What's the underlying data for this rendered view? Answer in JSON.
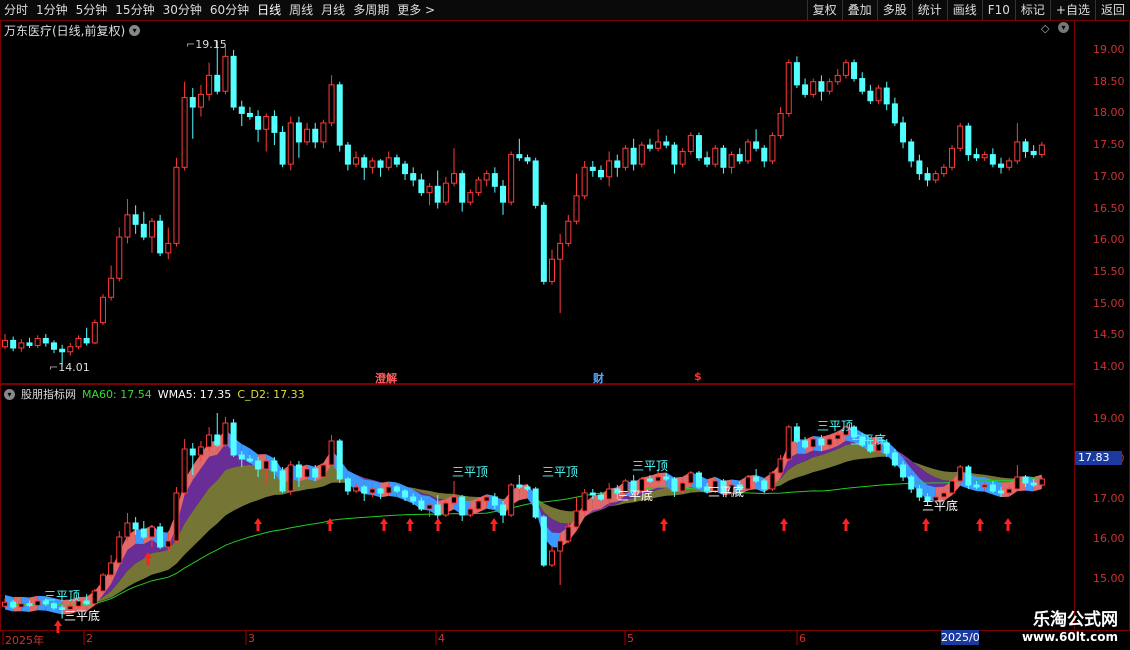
{
  "toolbar": {
    "periods": [
      "分时",
      "1分钟",
      "5分钟",
      "15分钟",
      "30分钟",
      "60分钟",
      "日线",
      "周线",
      "月线",
      "多周期",
      "更多 >"
    ],
    "active": "日线",
    "right_buttons": [
      "复权",
      "叠加",
      "多股",
      "统计",
      "画线",
      "F10",
      "标记",
      "+自选",
      "返回"
    ]
  },
  "stock": {
    "title": "万东医疗(日线,前复权)",
    "high_label": "19.15",
    "low_label": "14.01"
  },
  "main_axis": [
    "19.00",
    "18.50",
    "18.00",
    "17.50",
    "17.00",
    "16.50",
    "16.00",
    "15.50",
    "15.00",
    "14.50",
    "14.00"
  ],
  "events": [
    {
      "label": "澄解",
      "color": "#ff6060"
    },
    {
      "label": "财",
      "color": "#55aaff"
    },
    {
      "label": "$",
      "color": "#ff3030"
    }
  ],
  "indicator": {
    "name": "股朋指标网",
    "ma60_label": "MA60: 17.54",
    "wma5_label": "WMA5: 17.35",
    "cd2_label": "C_D2: 17.33",
    "current": "17.83",
    "axis": [
      "19.00",
      "18.00",
      "17.00",
      "16.00",
      "15.00"
    ],
    "signals": [
      "三平顶",
      "三平顶",
      "三平顶",
      "三平顶",
      "三平顶",
      "三平底",
      "三平底",
      "三平底",
      "三平底",
      "三平底"
    ]
  },
  "dates": [
    "2025年",
    "2",
    "3",
    "4",
    "5",
    "6",
    "2025/0"
  ],
  "watermark": {
    "line1": "乐淘公式网",
    "line2": "www.60lt.com"
  },
  "colors": {
    "up": "#ff3b3b",
    "down": "#54ffff",
    "ma60": "#22cc22",
    "purple": "#7a35b0",
    "olive": "#8a8a40",
    "pink": "#e06a6a",
    "blue": "#3a9aff"
  },
  "candles": [
    [
      14.32,
      14.42,
      14.52,
      14.28
    ],
    [
      14.42,
      14.3,
      14.48,
      14.25
    ],
    [
      14.3,
      14.38,
      14.44,
      14.24
    ],
    [
      14.38,
      14.34,
      14.46,
      14.3
    ],
    [
      14.34,
      14.45,
      14.5,
      14.3
    ],
    [
      14.45,
      14.38,
      14.52,
      14.32
    ],
    [
      14.38,
      14.28,
      14.42,
      14.22
    ],
    [
      14.28,
      14.24,
      14.35,
      14.01
    ],
    [
      14.24,
      14.32,
      14.38,
      14.18
    ],
    [
      14.32,
      14.45,
      14.5,
      14.28
    ],
    [
      14.45,
      14.38,
      14.62,
      14.34
    ],
    [
      14.38,
      14.7,
      14.75,
      14.36
    ],
    [
      14.7,
      15.1,
      15.15,
      14.66
    ],
    [
      15.1,
      15.4,
      15.6,
      15.05
    ],
    [
      15.4,
      16.05,
      16.2,
      15.35
    ],
    [
      16.05,
      16.4,
      16.65,
      15.95
    ],
    [
      16.4,
      16.25,
      16.55,
      16.1
    ],
    [
      16.25,
      16.05,
      16.45,
      16.0
    ],
    [
      16.05,
      16.3,
      16.35,
      15.8
    ],
    [
      16.3,
      15.8,
      16.4,
      15.75
    ],
    [
      15.8,
      15.95,
      16.2,
      15.7
    ],
    [
      15.95,
      17.15,
      17.3,
      15.9
    ],
    [
      17.15,
      18.25,
      18.5,
      17.1
    ],
    [
      18.25,
      18.1,
      18.4,
      17.6
    ],
    [
      18.1,
      18.3,
      18.45,
      17.95
    ],
    [
      18.3,
      18.6,
      18.8,
      18.2
    ],
    [
      18.6,
      18.35,
      19.15,
      18.3
    ],
    [
      18.35,
      18.9,
      19.05,
      18.3
    ],
    [
      18.9,
      18.1,
      19.0,
      18.05
    ],
    [
      18.1,
      18.0,
      18.2,
      17.8
    ],
    [
      18.0,
      17.95,
      18.1,
      17.9
    ],
    [
      17.95,
      17.75,
      18.05,
      17.55
    ],
    [
      17.75,
      17.95,
      18.0,
      17.4
    ],
    [
      17.95,
      17.7,
      18.05,
      17.5
    ],
    [
      17.7,
      17.2,
      17.8,
      17.15
    ],
    [
      17.2,
      17.85,
      17.95,
      17.1
    ],
    [
      17.85,
      17.55,
      17.95,
      17.3
    ],
    [
      17.55,
      17.75,
      17.85,
      17.5
    ],
    [
      17.75,
      17.55,
      17.85,
      17.45
    ],
    [
      17.55,
      17.85,
      17.9,
      17.45
    ],
    [
      17.85,
      18.45,
      18.6,
      17.8
    ],
    [
      18.45,
      17.5,
      18.5,
      17.4
    ],
    [
      17.5,
      17.2,
      17.55,
      17.1
    ],
    [
      17.2,
      17.3,
      17.4,
      17.15
    ],
    [
      17.3,
      17.15,
      17.35,
      16.95
    ],
    [
      17.15,
      17.25,
      17.3,
      17.05
    ],
    [
      17.25,
      17.15,
      17.28,
      17.0
    ],
    [
      17.15,
      17.3,
      17.4,
      17.1
    ],
    [
      17.3,
      17.2,
      17.35,
      17.15
    ],
    [
      17.2,
      17.05,
      17.25,
      16.95
    ],
    [
      17.05,
      16.95,
      17.15,
      16.85
    ],
    [
      16.95,
      16.75,
      17.05,
      16.7
    ],
    [
      16.75,
      16.85,
      16.9,
      16.55
    ],
    [
      16.85,
      16.6,
      17.1,
      16.5
    ],
    [
      16.6,
      16.9,
      17.0,
      16.55
    ],
    [
      16.9,
      17.05,
      17.45,
      16.85
    ],
    [
      17.05,
      16.6,
      17.1,
      16.45
    ],
    [
      16.6,
      16.75,
      16.8,
      16.55
    ],
    [
      16.75,
      16.95,
      17.0,
      16.7
    ],
    [
      16.95,
      17.05,
      17.1,
      16.85
    ],
    [
      17.05,
      16.85,
      17.15,
      16.75
    ],
    [
      16.85,
      16.6,
      16.95,
      16.4
    ],
    [
      16.6,
      17.35,
      17.4,
      16.55
    ],
    [
      17.35,
      17.3,
      17.6,
      17.25
    ],
    [
      17.3,
      17.25,
      17.35,
      17.2
    ],
    [
      17.25,
      16.55,
      17.3,
      16.5
    ],
    [
      16.55,
      15.35,
      16.6,
      15.3
    ],
    [
      15.35,
      15.7,
      15.85,
      15.3
    ],
    [
      15.7,
      15.95,
      16.1,
      14.85
    ],
    [
      15.95,
      16.3,
      16.4,
      15.9
    ],
    [
      16.3,
      16.7,
      17.05,
      16.25
    ],
    [
      16.7,
      17.15,
      17.25,
      16.65
    ],
    [
      17.15,
      17.1,
      17.25,
      17.0
    ],
    [
      17.1,
      17.0,
      17.18,
      16.95
    ],
    [
      17.0,
      17.25,
      17.4,
      16.85
    ],
    [
      17.25,
      17.15,
      17.35,
      17.0
    ],
    [
      17.15,
      17.45,
      17.5,
      17.1
    ],
    [
      17.45,
      17.2,
      17.6,
      17.1
    ],
    [
      17.2,
      17.5,
      17.55,
      17.15
    ],
    [
      17.5,
      17.45,
      17.6,
      17.4
    ],
    [
      17.45,
      17.55,
      17.75,
      17.4
    ],
    [
      17.55,
      17.5,
      17.65,
      17.45
    ],
    [
      17.5,
      17.2,
      17.55,
      17.05
    ],
    [
      17.2,
      17.4,
      17.45,
      17.15
    ],
    [
      17.4,
      17.65,
      17.7,
      17.35
    ],
    [
      17.65,
      17.3,
      17.7,
      17.25
    ],
    [
      17.3,
      17.2,
      17.4,
      17.15
    ],
    [
      17.2,
      17.45,
      17.5,
      17.15
    ],
    [
      17.45,
      17.15,
      17.5,
      17.05
    ],
    [
      17.15,
      17.35,
      17.4,
      17.05
    ],
    [
      17.35,
      17.25,
      17.45,
      17.2
    ],
    [
      17.25,
      17.55,
      17.6,
      17.2
    ],
    [
      17.55,
      17.45,
      17.75,
      17.4
    ],
    [
      17.45,
      17.25,
      17.5,
      17.15
    ],
    [
      17.25,
      17.65,
      17.7,
      17.2
    ],
    [
      17.65,
      18.0,
      18.1,
      17.6
    ],
    [
      18.0,
      18.8,
      18.85,
      17.95
    ],
    [
      18.8,
      18.45,
      18.9,
      18.4
    ],
    [
      18.45,
      18.3,
      18.55,
      18.25
    ],
    [
      18.3,
      18.5,
      18.55,
      18.25
    ],
    [
      18.5,
      18.35,
      18.6,
      18.2
    ],
    [
      18.35,
      18.5,
      18.55,
      18.3
    ],
    [
      18.5,
      18.6,
      18.7,
      18.45
    ],
    [
      18.6,
      18.8,
      18.85,
      18.55
    ],
    [
      18.8,
      18.55,
      18.85,
      18.5
    ],
    [
      18.55,
      18.35,
      18.65,
      18.3
    ],
    [
      18.35,
      18.2,
      18.45,
      18.15
    ],
    [
      18.2,
      18.4,
      18.45,
      18.15
    ],
    [
      18.4,
      18.15,
      18.5,
      18.05
    ],
    [
      18.15,
      17.85,
      18.25,
      17.8
    ],
    [
      17.85,
      17.55,
      17.95,
      17.45
    ],
    [
      17.55,
      17.25,
      17.6,
      17.15
    ],
    [
      17.25,
      17.05,
      17.35,
      16.95
    ],
    [
      17.05,
      16.95,
      17.15,
      16.85
    ],
    [
      16.95,
      17.05,
      17.1,
      16.9
    ],
    [
      17.05,
      17.15,
      17.2,
      17.0
    ],
    [
      17.15,
      17.45,
      17.5,
      17.1
    ],
    [
      17.45,
      17.8,
      17.85,
      17.4
    ],
    [
      17.8,
      17.35,
      17.85,
      17.25
    ],
    [
      17.35,
      17.3,
      17.45,
      17.25
    ],
    [
      17.3,
      17.35,
      17.4,
      17.25
    ],
    [
      17.35,
      17.2,
      17.45,
      17.15
    ],
    [
      17.2,
      17.15,
      17.3,
      17.05
    ],
    [
      17.15,
      17.25,
      17.3,
      17.1
    ],
    [
      17.25,
      17.55,
      17.85,
      17.2
    ],
    [
      17.55,
      17.4,
      17.6,
      17.3
    ],
    [
      17.4,
      17.35,
      17.5,
      17.3
    ],
    [
      17.35,
      17.5,
      17.55,
      17.3
    ]
  ]
}
